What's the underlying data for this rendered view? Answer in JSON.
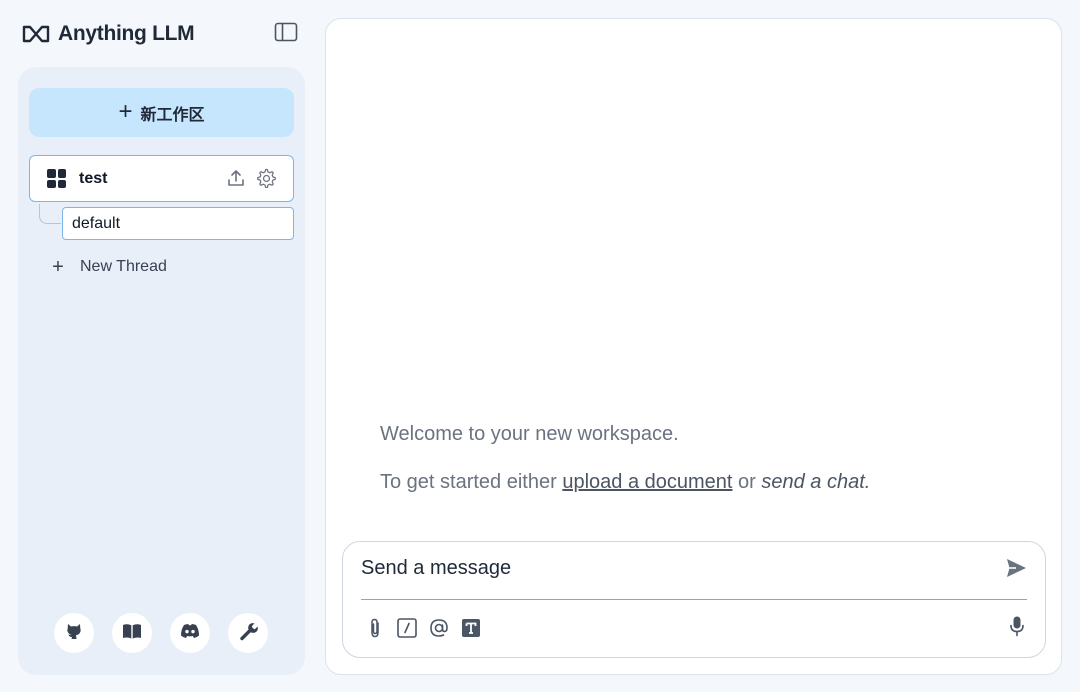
{
  "brand": {
    "name": "Anything LLM",
    "logo_icon": "anythingllm-logo-icon"
  },
  "sidebar": {
    "toggle_icon": "sidebar-toggle-icon",
    "new_workspace_label": "新工作区",
    "workspaces": [
      {
        "name": "test",
        "icon": "workspace-grid-icon",
        "actions": [
          "upload-icon",
          "gear-icon"
        ]
      }
    ],
    "threads": [
      {
        "label": "default"
      }
    ],
    "new_thread_label": "New Thread",
    "footer_icons": [
      "github-icon",
      "book-icon",
      "discord-icon",
      "wrench-icon"
    ]
  },
  "main": {
    "welcome_line": "Welcome to your new workspace.",
    "start_prefix": "To get started either ",
    "upload_link": "upload a document",
    "or_text": " or ",
    "send_link": "send a chat."
  },
  "composer": {
    "placeholder": "Send a message",
    "tools": [
      "paperclip-icon",
      "slash-command-icon",
      "at-mention-icon",
      "text-size-icon"
    ],
    "send_icon": "send-icon",
    "mic_icon": "microphone-icon"
  },
  "colors": {
    "background": "#f4f7fb",
    "sidebar_panel": "#e9eff9",
    "accent_button": "#c6e6fd",
    "active_border": "#7db6ec",
    "text_dark": "#1f2937",
    "text_muted": "#6b7280"
  }
}
